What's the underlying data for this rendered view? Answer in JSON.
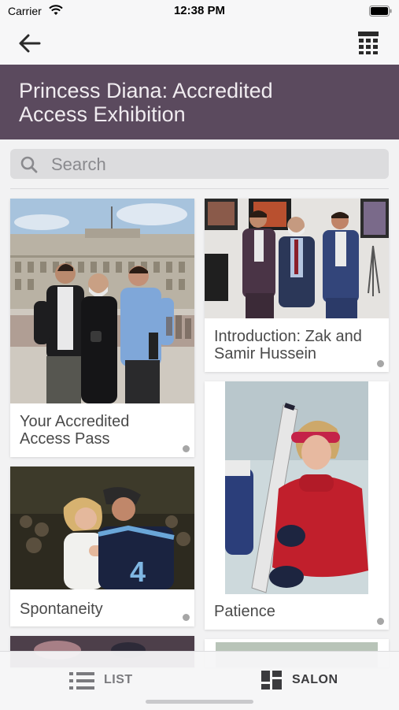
{
  "status": {
    "carrier": "Carrier",
    "time": "12:38 PM"
  },
  "nav": {
    "back_icon": "back-arrow-icon",
    "right_icon": "calculator-grid-icon"
  },
  "header": {
    "title": "Princess Diana: Accredited Access Exhibition",
    "background": "#5b4a5e"
  },
  "search": {
    "placeholder": "Search",
    "value": ""
  },
  "cards": [
    {
      "label": "Your Accredited Access Pass"
    },
    {
      "label": "Introduction: Zak and Samir Hussein"
    },
    {
      "label": "Spontaneity"
    },
    {
      "label": "Patience"
    }
  ],
  "tabs": [
    {
      "label": "LIST",
      "icon": "list-icon",
      "selected": false
    },
    {
      "label": "SALON",
      "icon": "salon-grid-icon",
      "selected": true
    }
  ]
}
